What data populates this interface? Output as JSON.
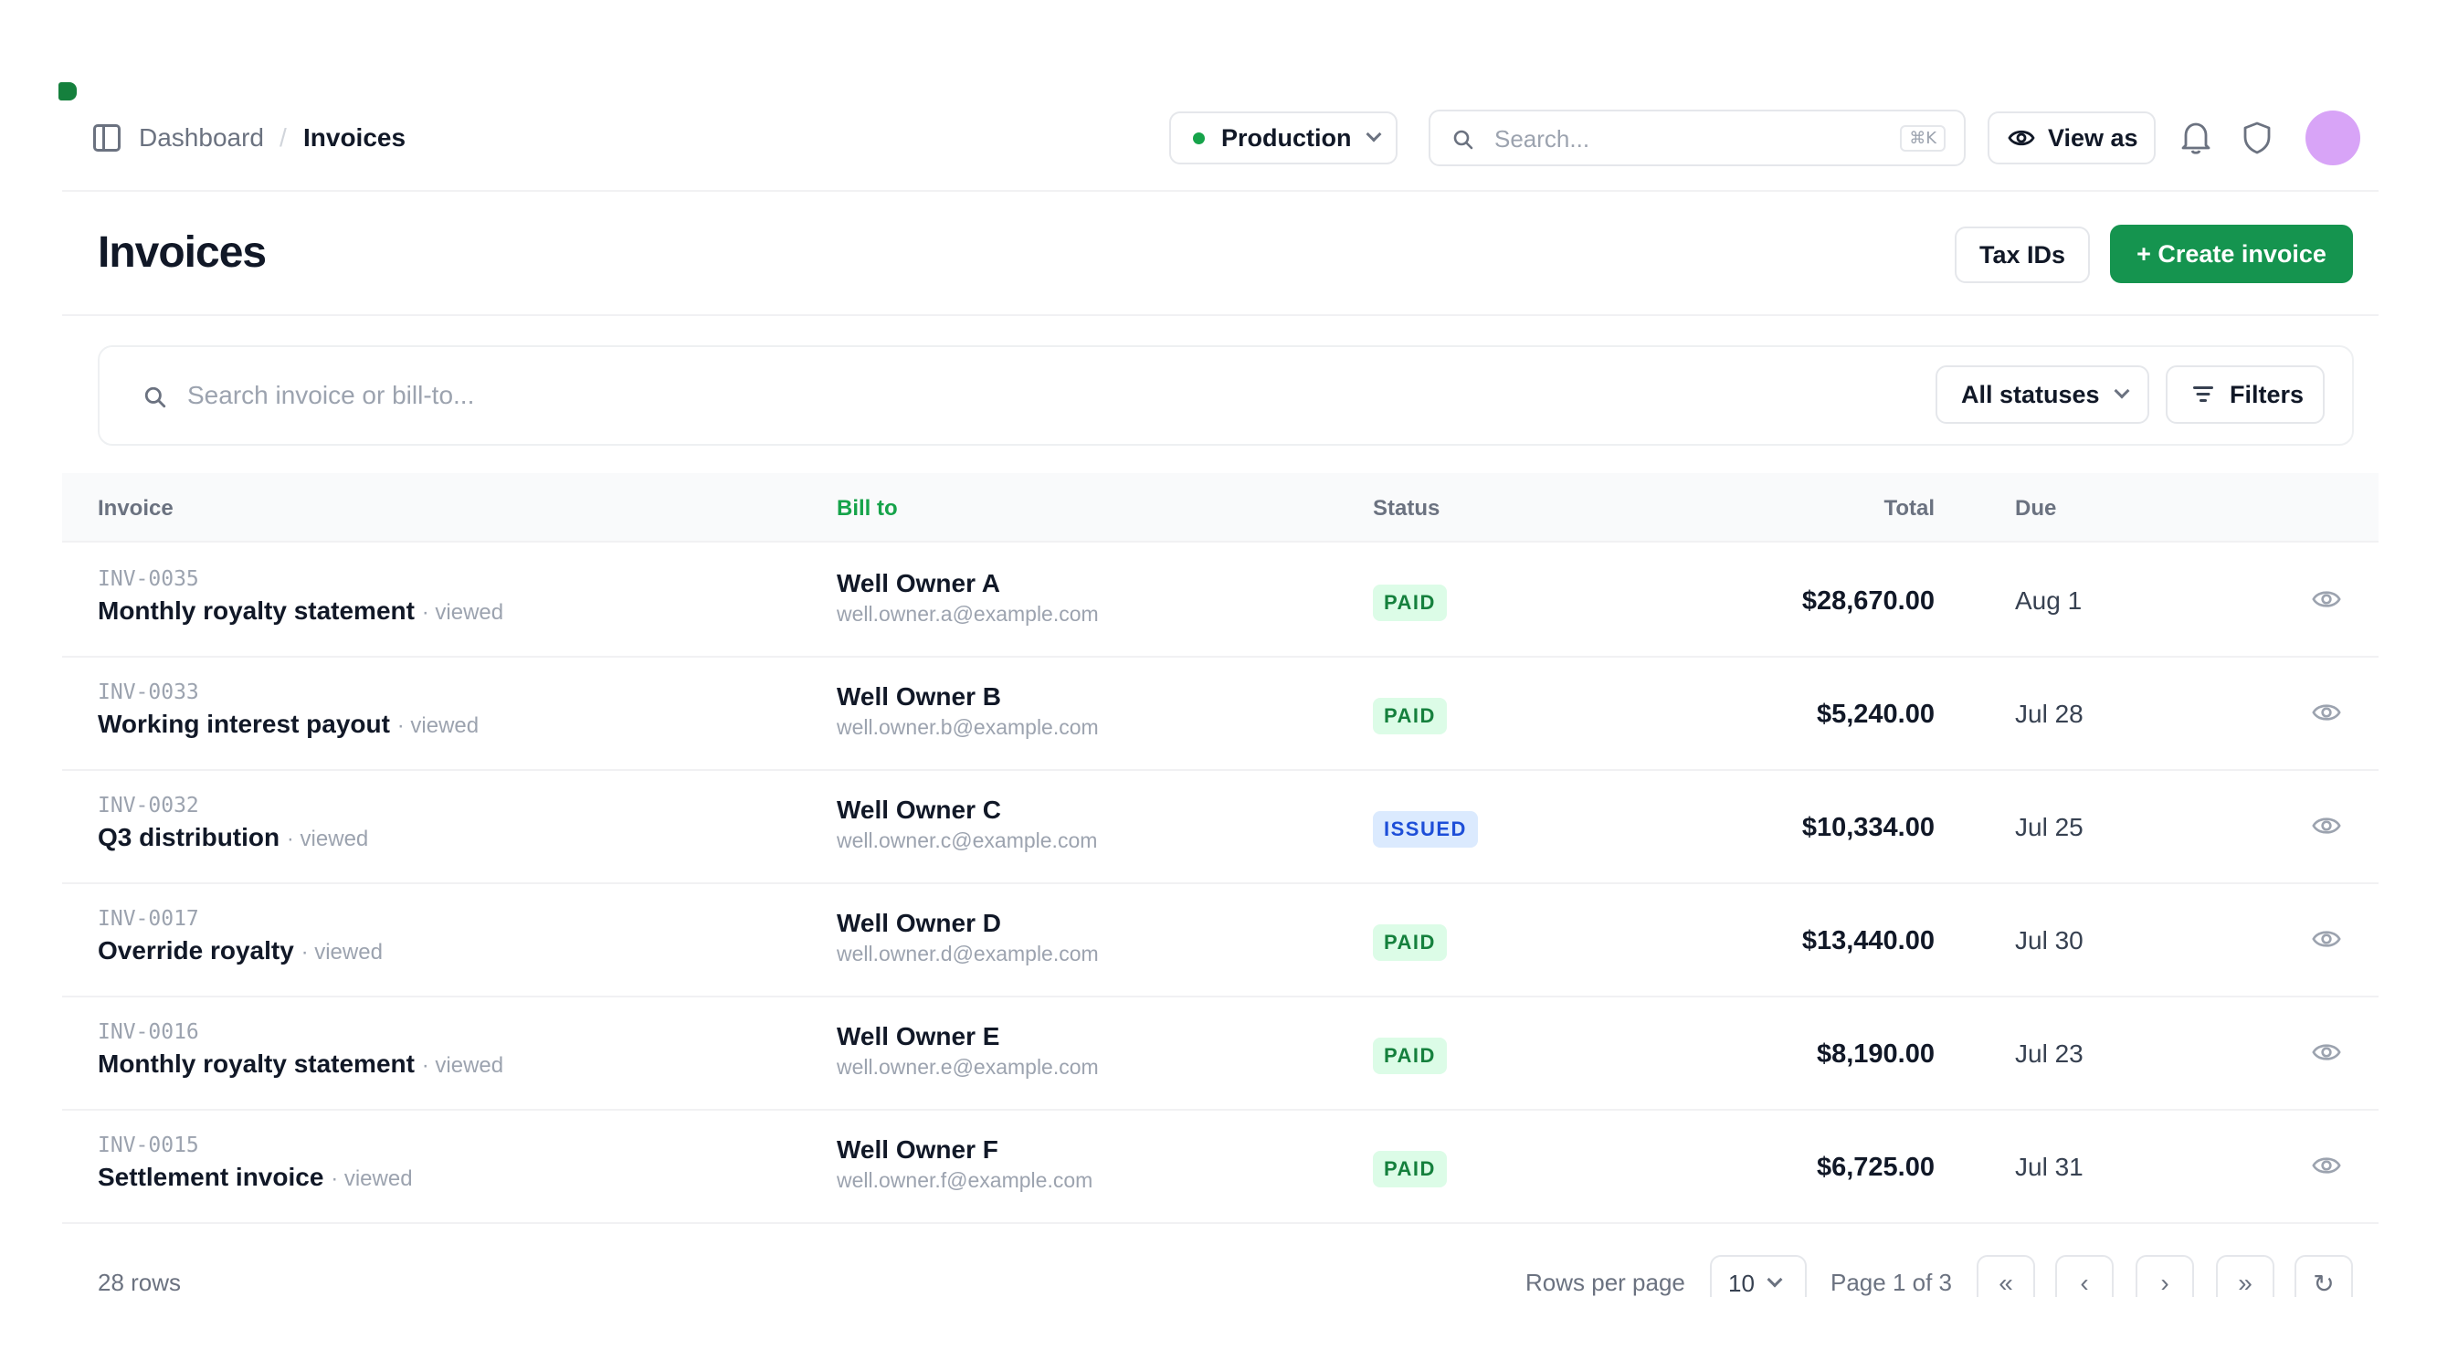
{
  "breadcrumb": {
    "parent": "Dashboard",
    "separator": "/",
    "current": "Invoices"
  },
  "topbar": {
    "environment": "Production",
    "environment_status_color": "#16a34a",
    "search_placeholder": "Search...",
    "search_shortcut": "⌘K",
    "view_as_label": "View as",
    "icons": [
      "sidebar-toggle-icon",
      "chevron-down-icon",
      "search-icon",
      "eye-icon",
      "bell-icon",
      "shield-icon"
    ],
    "avatar_color": "#d8a4f7"
  },
  "page": {
    "title": "Invoices",
    "tax_ids_label": "Tax IDs",
    "create_label": "+ Create invoice",
    "accent_color": "#15944f"
  },
  "filters": {
    "search_placeholder": "Search invoice or bill-to...",
    "status_select": "All statuses",
    "filters_label": "Filters"
  },
  "table": {
    "columns": {
      "invoice": "Invoice",
      "bill_to": "Bill to",
      "status": "Status",
      "total": "Total",
      "due": "Due"
    },
    "rows": [
      {
        "id": "INV-0035",
        "desc": "Monthly royalty statement",
        "viewed": "· viewed",
        "owner": "Well Owner A",
        "email": "well.owner.a@example.com",
        "status": "PAID",
        "total": "$28,670.00",
        "due": "Aug 1"
      },
      {
        "id": "INV-0033",
        "desc": "Working interest payout",
        "viewed": "· viewed",
        "owner": "Well Owner B",
        "email": "well.owner.b@example.com",
        "status": "PAID",
        "total": "$5,240.00",
        "due": "Jul 28"
      },
      {
        "id": "INV-0032",
        "desc": "Q3 distribution",
        "viewed": "· viewed",
        "owner": "Well Owner C",
        "email": "well.owner.c@example.com",
        "status": "ISSUED",
        "total": "$10,334.00",
        "due": "Jul 25"
      },
      {
        "id": "INV-0017",
        "desc": "Override royalty",
        "viewed": "· viewed",
        "owner": "Well Owner D",
        "email": "well.owner.d@example.com",
        "status": "PAID",
        "total": "$13,440.00",
        "due": "Jul 30"
      },
      {
        "id": "INV-0016",
        "desc": "Monthly royalty statement",
        "viewed": "· viewed",
        "owner": "Well Owner E",
        "email": "well.owner.e@example.com",
        "status": "PAID",
        "total": "$8,190.00",
        "due": "Jul 23"
      },
      {
        "id": "INV-0015",
        "desc": "Settlement invoice",
        "viewed": "· viewed",
        "owner": "Well Owner F",
        "email": "well.owner.f@example.com",
        "status": "PAID",
        "total": "$6,725.00",
        "due": "Jul 31"
      }
    ]
  },
  "footer": {
    "rows_count": "28 rows",
    "rows_per_page_label": "Rows per page",
    "rows_per_page": "10",
    "page_label": "Page 1 of 3",
    "first": "«",
    "prev": "‹",
    "next": "›",
    "last": "»",
    "refresh": "↻"
  }
}
